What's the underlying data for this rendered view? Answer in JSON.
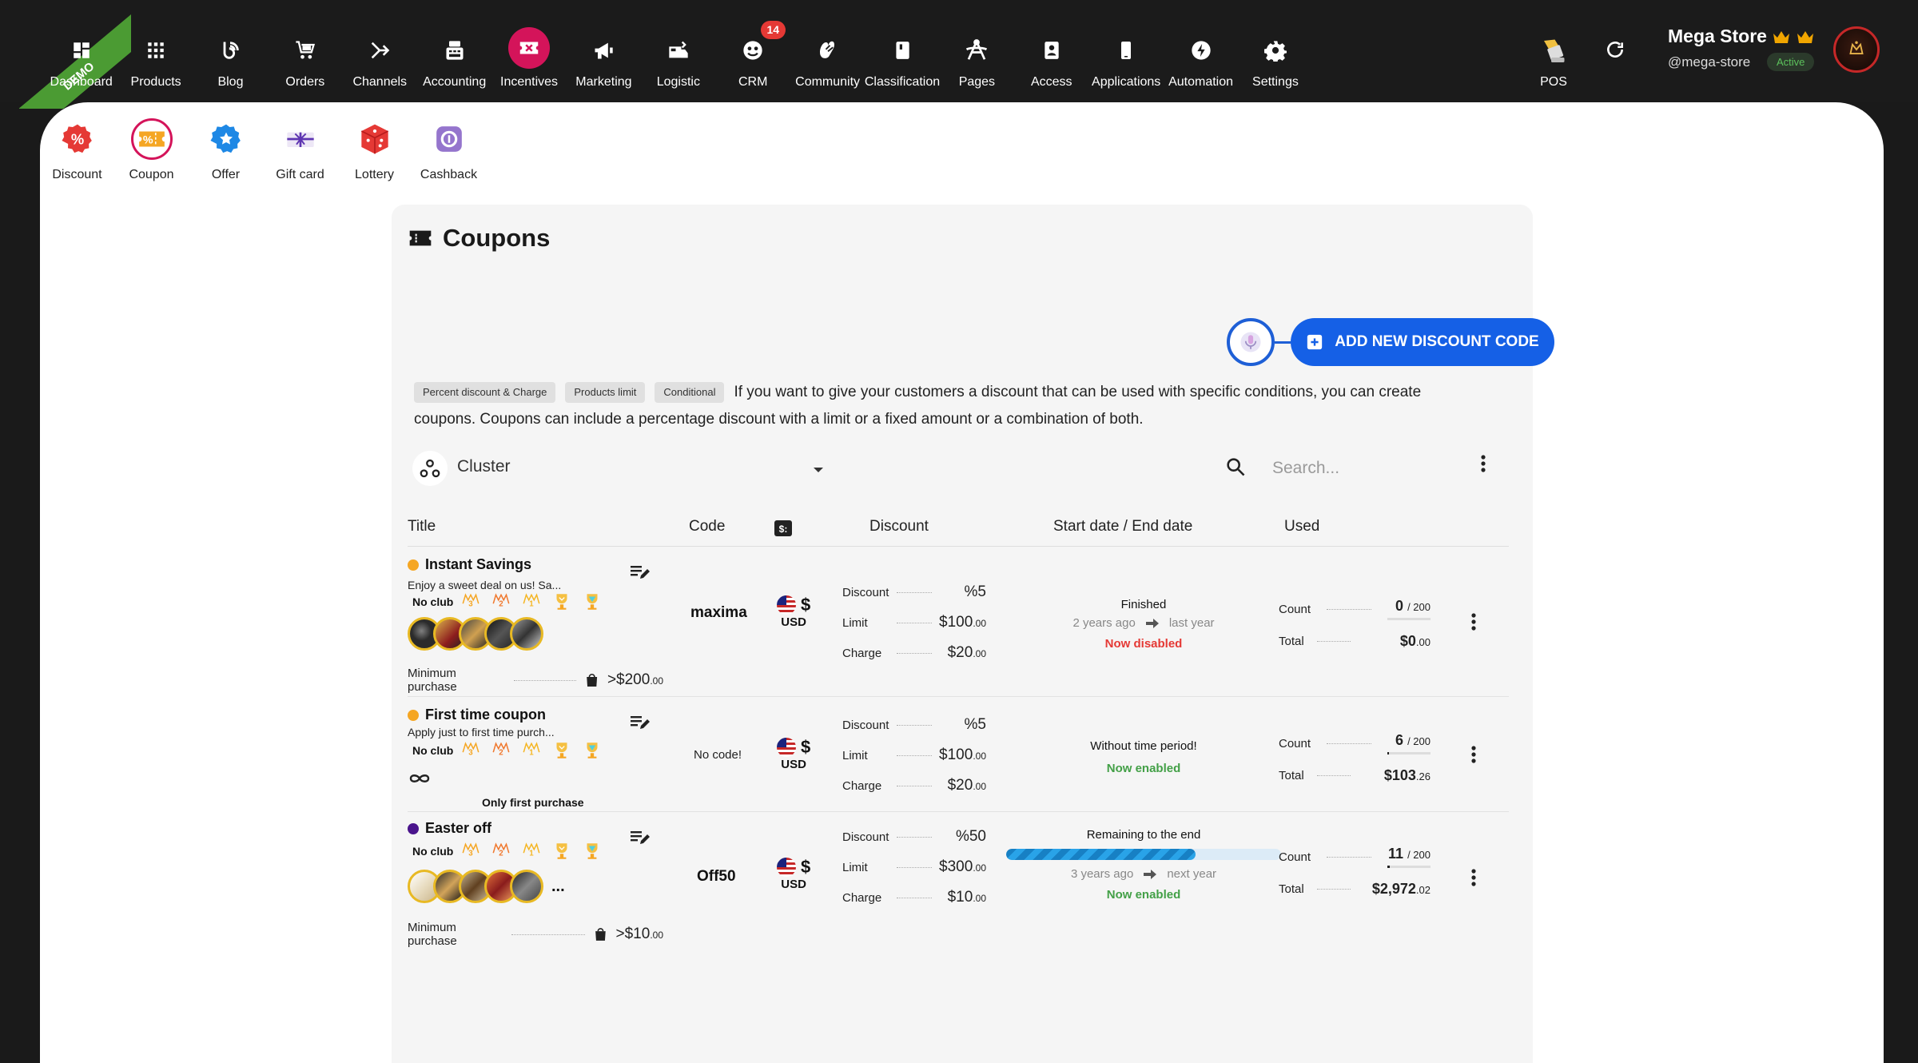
{
  "demo_ribbon": "DEMO",
  "nav": [
    {
      "label": "Dashboard",
      "icon": "dashboard-icon"
    },
    {
      "label": "Products",
      "icon": "grid-icon"
    },
    {
      "label": "Blog",
      "icon": "blog-icon"
    },
    {
      "label": "Orders",
      "icon": "cart-icon"
    },
    {
      "label": "Channels",
      "icon": "channels-icon"
    },
    {
      "label": "Accounting",
      "icon": "accounting-icon"
    },
    {
      "label": "Incentives",
      "icon": "ticket-icon",
      "active": true
    },
    {
      "label": "Marketing",
      "icon": "megaphone-icon"
    },
    {
      "label": "Logistic",
      "icon": "truck-icon"
    },
    {
      "label": "CRM",
      "icon": "crm-icon",
      "badge": "14"
    },
    {
      "label": "Community",
      "icon": "community-icon"
    },
    {
      "label": "Classification",
      "icon": "book-icon"
    },
    {
      "label": "Pages",
      "icon": "pages-icon"
    },
    {
      "label": "Access",
      "icon": "access-icon"
    },
    {
      "label": "Applications",
      "icon": "phone-icon"
    },
    {
      "label": "Automation",
      "icon": "bolt-icon"
    },
    {
      "label": "Settings",
      "icon": "gear-icon"
    }
  ],
  "pos_label": "POS",
  "store": {
    "name": "Mega Store",
    "handle": "@mega-store",
    "status": "Active"
  },
  "subnav": [
    {
      "label": "Discount",
      "icon": "discount-icon"
    },
    {
      "label": "Coupon",
      "icon": "coupon-icon",
      "active": true
    },
    {
      "label": "Offer",
      "icon": "offer-icon"
    },
    {
      "label": "Gift card",
      "icon": "gift-card-icon"
    },
    {
      "label": "Lottery",
      "icon": "dice-icon"
    },
    {
      "label": "Cashback",
      "icon": "cashback-icon"
    }
  ],
  "page": {
    "title": "Coupons",
    "add_button": "ADD NEW DISCOUNT CODE",
    "tags": [
      "Percent discount & Charge",
      "Products limit",
      "Conditional"
    ],
    "description": "If you want to give your customers a discount that can be used with specific conditions, you can create coupons. Coupons can include a percentage discount with a limit or a fixed amount or a combination of both.",
    "cluster_label": "Cluster",
    "search_placeholder": "Search..."
  },
  "columns": {
    "title": "Title",
    "code": "Code",
    "discount": "Discount",
    "dates": "Start date / End date",
    "used": "Used"
  },
  "labels": {
    "no_club": "No club",
    "minimum_purchase": "Minimum purchase",
    "discount": "Discount",
    "limit": "Limit",
    "charge": "Charge",
    "count": "Count",
    "total": "Total",
    "usd": "USD",
    "currency_symbol": "$"
  },
  "coupons": [
    {
      "title": "Instant Savings",
      "dot_color": "#f5a623",
      "description": "Enjoy a sweet deal on us! Sa...",
      "code": "maxima",
      "min_purchase": ">$200",
      "min_purchase_cents": ".00",
      "discount": "%5",
      "limit": "$100",
      "limit_cents": ".00",
      "charge": "$20",
      "charge_cents": ".00",
      "date_status": "Finished",
      "date_from": "2 years ago",
      "date_to": "last year",
      "state": "Now disabled",
      "count": "0",
      "count_max": "/ 200",
      "count_fraction": 0,
      "total": "$0",
      "total_cents": ".00"
    },
    {
      "title": "First time coupon",
      "dot_color": "#f5a623",
      "description": "Apply just to first time purch...",
      "code": "No code!",
      "only_first": "Only first purchase",
      "discount": "%5",
      "limit": "$100",
      "limit_cents": ".00",
      "charge": "$20",
      "charge_cents": ".00",
      "date_status": "Without time period!",
      "state": "Now enabled",
      "count": "6",
      "count_max": "/ 200",
      "count_fraction": 0.03,
      "total": "$103",
      "total_cents": ".26"
    },
    {
      "title": "Easter off",
      "dot_color": "#4a148c",
      "code": "Off50",
      "min_purchase": ">$10",
      "min_purchase_cents": ".00",
      "more": "...",
      "discount": "%50",
      "limit": "$300",
      "limit_cents": ".00",
      "charge": "$10",
      "charge_cents": ".00",
      "date_status": "Remaining to the end",
      "progress": 0.69,
      "date_from": "3 years ago",
      "date_to": "next year",
      "state": "Now enabled",
      "count": "11",
      "count_max": "/ 200",
      "count_fraction": 0.055,
      "total": "$2,972",
      "total_cents": ".02"
    }
  ]
}
